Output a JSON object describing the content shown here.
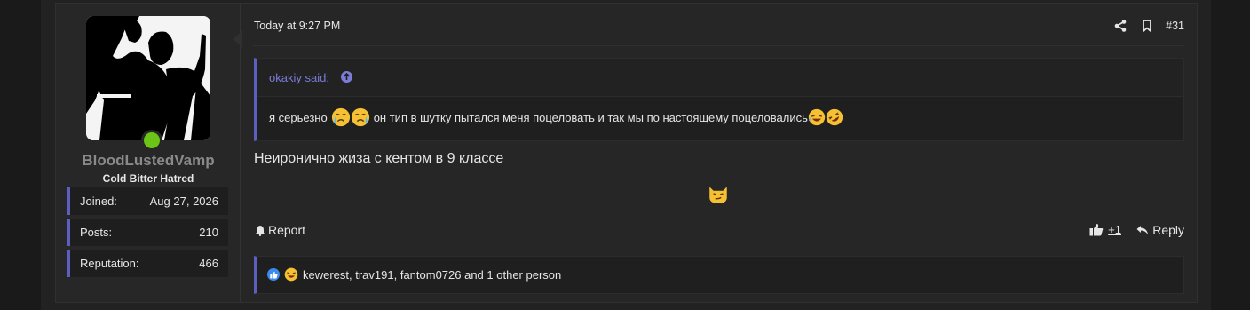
{
  "user": {
    "name": "BloodLustedVamp",
    "title": "Cold Bitter Hatred",
    "stats": [
      {
        "label": "Joined:",
        "value": "Aug 27, 2026"
      },
      {
        "label": "Posts:",
        "value": "210"
      },
      {
        "label": "Reputation:",
        "value": "466"
      }
    ],
    "online_color": "#6cc417"
  },
  "post": {
    "date": "Today at 9:27 PM",
    "number": "#31",
    "icons": [
      "share-icon",
      "bookmark-icon"
    ],
    "quote": {
      "author": "okakiy said:",
      "text_part1": "я серьезно",
      "text_part2": "он тип в шутку пытался меня поцеловать и так мы по настоящему поцеловались"
    },
    "message": "Неиронично жиза с кентом в 9 классе",
    "actions": {
      "report": "Report",
      "like_count": "+1",
      "reply": "Reply"
    },
    "reactions_text": "kewerest, trav191, fantom0726 and 1 other person"
  },
  "colors": {
    "accent": "#5c5fc0",
    "link": "#7a7cd6",
    "background": "#262626"
  }
}
